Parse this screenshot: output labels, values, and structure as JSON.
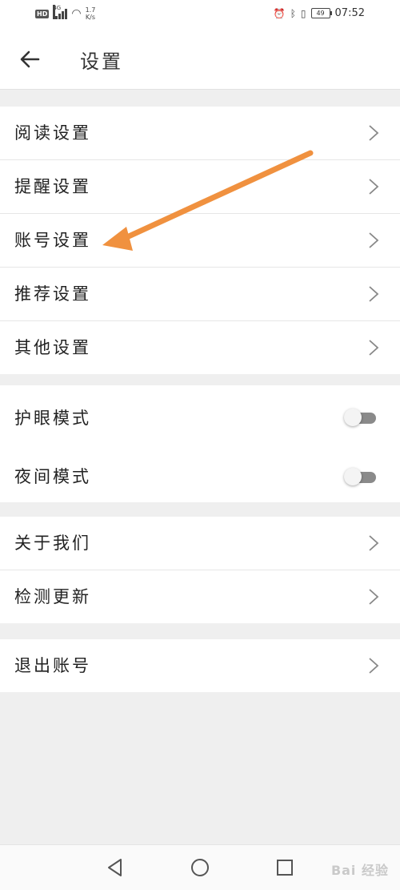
{
  "status_bar": {
    "hd": "HD",
    "network": "4G",
    "speed_value": "1.7",
    "speed_unit": "K/s",
    "battery": "49",
    "time": "07:52"
  },
  "header": {
    "title": "设置",
    "back_icon": "arrow-left-icon"
  },
  "groups": {
    "settings": [
      {
        "label": "阅读设置"
      },
      {
        "label": "提醒设置"
      },
      {
        "label": "账号设置"
      },
      {
        "label": "推荐设置"
      },
      {
        "label": "其他设置"
      }
    ],
    "eye_mode": {
      "label": "护眼模式",
      "enabled": false
    },
    "night_mode": {
      "label": "夜间模式",
      "enabled": false
    },
    "about": [
      {
        "label": "关于我们"
      },
      {
        "label": "检测更新"
      }
    ],
    "logout": {
      "label": "退出账号"
    }
  },
  "colors": {
    "annotation_arrow": "#f0913f",
    "background": "#efefef"
  },
  "watermark": "Bai 经验"
}
